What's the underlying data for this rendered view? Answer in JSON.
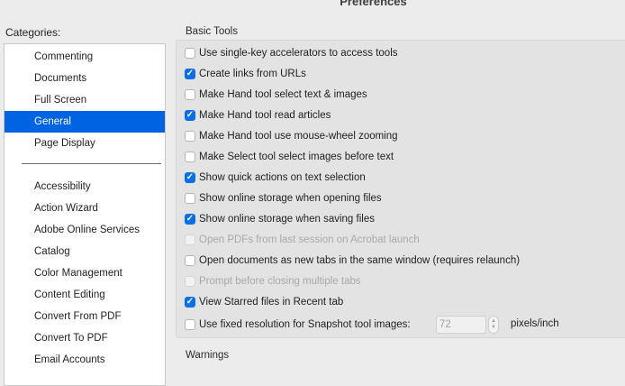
{
  "window": {
    "title": "Preferences"
  },
  "sidebar": {
    "label": "Categories:",
    "items": [
      {
        "label": "Commenting"
      },
      {
        "label": "Documents"
      },
      {
        "label": "Full Screen"
      },
      {
        "label": "General",
        "selected": true
      },
      {
        "label": "Page Display"
      },
      {
        "label": "Accessibility"
      },
      {
        "label": "Action Wizard"
      },
      {
        "label": "Adobe Online Services"
      },
      {
        "label": "Catalog"
      },
      {
        "label": "Color Management"
      },
      {
        "label": "Content Editing"
      },
      {
        "label": "Convert From PDF"
      },
      {
        "label": "Convert To PDF"
      },
      {
        "label": "Email Accounts"
      }
    ]
  },
  "basic_tools": {
    "title": "Basic Tools",
    "options": [
      {
        "label": "Use single-key accelerators to access tools",
        "checked": false,
        "enabled": true
      },
      {
        "label": "Create links from URLs",
        "checked": true,
        "enabled": true
      },
      {
        "label": "Make Hand tool select text & images",
        "checked": false,
        "enabled": true
      },
      {
        "label": "Make Hand tool read articles",
        "checked": true,
        "enabled": true
      },
      {
        "label": "Make Hand tool use mouse-wheel zooming",
        "checked": false,
        "enabled": true
      },
      {
        "label": "Make Select tool select images before text",
        "checked": false,
        "enabled": true
      },
      {
        "label": "Show quick actions on text selection",
        "checked": true,
        "enabled": true
      },
      {
        "label": "Show online storage when opening files",
        "checked": false,
        "enabled": true
      },
      {
        "label": "Show online storage when saving files",
        "checked": true,
        "enabled": true
      },
      {
        "label": "Open PDFs from last session on Acrobat launch",
        "checked": false,
        "enabled": false
      },
      {
        "label": "Open documents as new tabs in the same window (requires relaunch)",
        "checked": false,
        "enabled": true
      },
      {
        "label": "Prompt before closing multiple tabs",
        "checked": false,
        "enabled": false
      },
      {
        "label": "View Starred files in Recent tab",
        "checked": true,
        "enabled": true
      },
      {
        "label": "Use fixed resolution for Snapshot tool images:",
        "checked": false,
        "enabled": true
      }
    ],
    "snapshot_resolution": {
      "value": "72",
      "unit": "pixels/inch"
    }
  },
  "warnings": {
    "title": "Warnings"
  },
  "colors": {
    "accent": "#0063e1",
    "checkbox_on": "#0a6fe6"
  }
}
